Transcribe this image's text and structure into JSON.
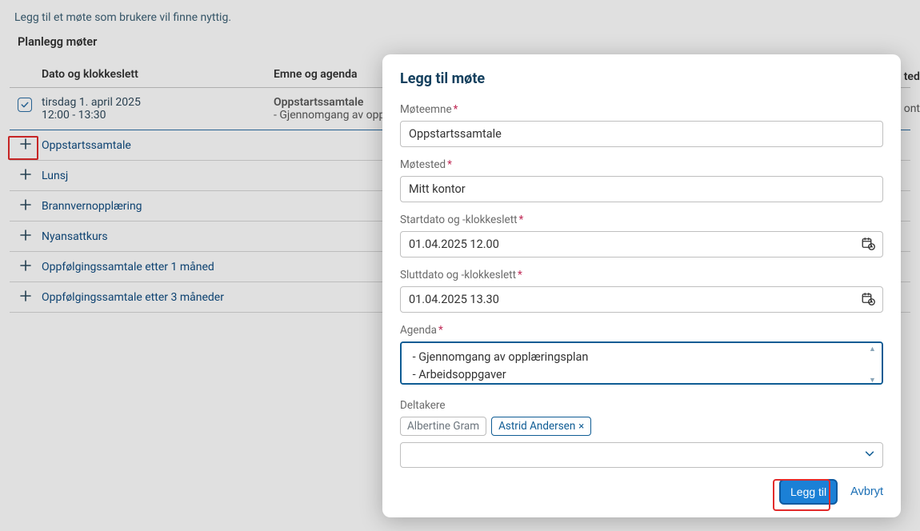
{
  "helper_text": "Legg til et møte som brukere vil finne nyttig.",
  "section_title": "Planlegg møter",
  "columns": {
    "date": "Dato og klokkeslett",
    "subject": "Emne og agenda",
    "location_partial": "ted"
  },
  "existing_row": {
    "date": "tirsdag 1. april 2025",
    "time": "12:00 - 13:30",
    "subject": "Oppstartssamtale",
    "agenda": "- Gjennomgang av opp",
    "location_partial": "ont"
  },
  "suggestions": [
    "Oppstartssamtale",
    "Lunsj",
    "Brannvernopplæring",
    "Nyansattkurs",
    "Oppfølgingssamtale etter 1 måned",
    "Oppfølgingssamtale etter 3 måneder"
  ],
  "modal": {
    "title": "Legg til møte",
    "labels": {
      "subject": "Møteemne",
      "location": "Møtested",
      "start": "Startdato og -klokkeslett",
      "end": "Sluttdato og -klokkeslett",
      "agenda": "Agenda",
      "participants": "Deltakere"
    },
    "values": {
      "subject": "Oppstartssamtale",
      "location": "Mitt kontor",
      "start": "01.04.2025 12.00",
      "end": "01.04.2025 13.30",
      "agenda": " - Gjennomgang av opplæringsplan\n - Arbeidsoppgaver"
    },
    "participants": [
      {
        "name": "Albertine Gram",
        "removable": false
      },
      {
        "name": "Astrid Andersen",
        "removable": true
      }
    ],
    "primary": "Legg til",
    "cancel": "Avbryt"
  }
}
